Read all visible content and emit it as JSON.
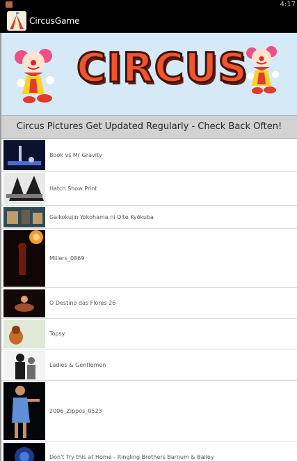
{
  "status_bar": {
    "time": "4:17"
  },
  "action_bar": {
    "title": "CircusGame"
  },
  "banner": {
    "wordmark": "CIRCUS"
  },
  "notice": "Circus Pictures Get Updated Regularly - Check Back Often!",
  "pictures": [
    {
      "title": "Book vs Mr Gravity",
      "thumb_colors": [
        "#0b1230",
        "#4a6bd1",
        "#c8c8e0"
      ]
    },
    {
      "title": "Hatch Show Print",
      "thumb_colors": [
        "#e8e8e8",
        "#1e1e1e",
        "#7a7a7a"
      ]
    },
    {
      "title": "Gaikokujin Yokohama ni Oite Kyōkuba",
      "thumb_colors": [
        "#2f4b55",
        "#c29b6b",
        "#6a5c4a"
      ]
    },
    {
      "title": "Millers_0869",
      "thumb_colors": [
        "#120505",
        "#f39a2b",
        "#6e1a10"
      ]
    },
    {
      "title": "O Destino das Flores 26",
      "thumb_colors": [
        "#120808",
        "#a05030",
        "#e0a070"
      ]
    },
    {
      "title": "Topsy",
      "thumb_colors": [
        "#dfe9d6",
        "#c46a2b",
        "#8a3c14"
      ]
    },
    {
      "title": "Ladies & Gentlemen",
      "thumb_colors": [
        "#f3f3f3",
        "#1b1b1b",
        "#6b6b6b"
      ]
    },
    {
      "title": "2006_Zippos_0523",
      "thumb_colors": [
        "#05060a",
        "#5f8fd6",
        "#c98f6c"
      ]
    },
    {
      "title": "Don't Try this at Home - Ringling Brothers Barnum & Bailey",
      "thumb_colors": [
        "#02030a",
        "#1e3a8a",
        "#4a7ad8"
      ]
    }
  ]
}
